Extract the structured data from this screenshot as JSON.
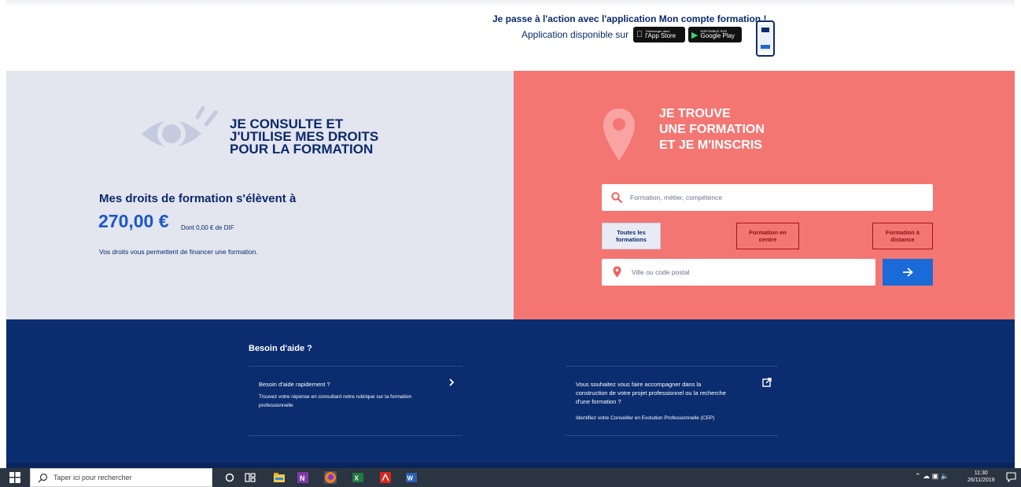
{
  "banner": {
    "title": "Je passe à l'action avec l'application Mon compte formation !",
    "available": "Application disponible sur",
    "app_store": {
      "small": "Télécharger dans",
      "big": "l'App Store"
    },
    "google_play": {
      "small": "DISPONIBLE SUR",
      "big": "Google Play"
    }
  },
  "left": {
    "heading": [
      "JE CONSULTE ET",
      "J'UTILISE MES DROITS",
      "POUR LA FORMATION"
    ],
    "rights_title": "Mes droits de formation s'élèvent à",
    "amount": "270,00 €",
    "dif": "Dont 0,00 € de DIF",
    "description": "Vos droits vous permettent de financer une formation."
  },
  "right": {
    "heading": [
      "JE TROUVE",
      "UNE FORMATION",
      "ET JE M'INSCRIS"
    ],
    "search_placeholder": "Formation, métier, compétence",
    "filters": {
      "all": "Toutes les formations",
      "centre": "Formation en centre",
      "distance": "Formation à distance"
    },
    "city_placeholder": "Ville ou code postal"
  },
  "footer": {
    "help_title": "Besoin d'aide ?",
    "card1": {
      "head": "Besoin d'aide rapidement ?",
      "body": "Trouvez votre réponse en consultant notre rubrique sur la formation professionnelle"
    },
    "card2": {
      "head": "Vous souhaitez vous faire accompagner dans la construction de votre projet professionnel ou la recherche d'une formation ?",
      "body": "Identifiez votre Conseiller en Evolution Professionnelle (CEP)"
    }
  },
  "taskbar": {
    "search_placeholder": "Taper ici pour rechercher",
    "time": "11:30",
    "date": "26/11/2019"
  },
  "colors": {
    "navy": "#0b2a6b",
    "accent_blue": "#1a57c8",
    "coral": "#f47673",
    "light_panel": "#e3e5ef"
  }
}
